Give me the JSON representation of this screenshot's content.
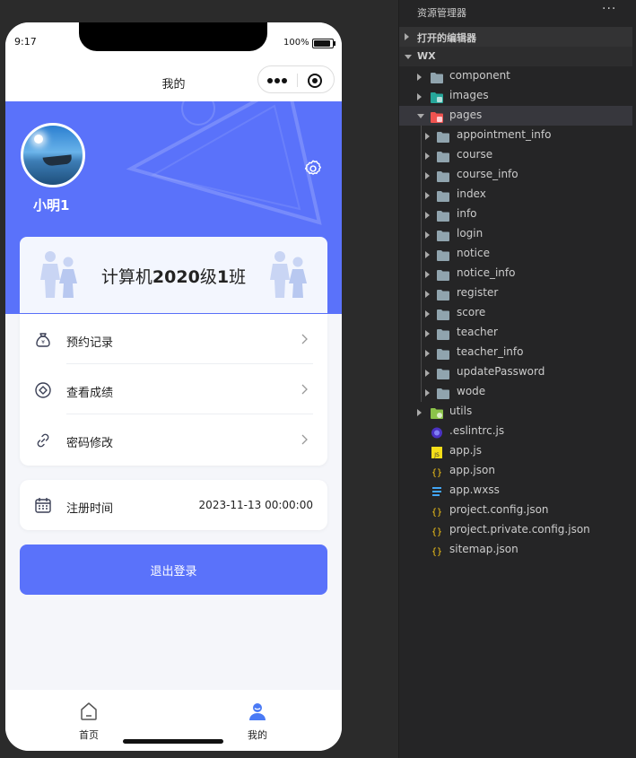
{
  "phone": {
    "status_time": "9:17",
    "battery_text": "100%",
    "nav_title": "我的",
    "username": "小明1",
    "class_prefix": "计算机",
    "class_year": "2020",
    "class_mid": "级",
    "class_num": "1",
    "class_suffix": "班",
    "menu": [
      {
        "label": "预约记录",
        "icon": "money-bag-icon"
      },
      {
        "label": "查看成绩",
        "icon": "diamond-circle-icon"
      },
      {
        "label": "密码修改",
        "icon": "link-icon"
      }
    ],
    "register": {
      "label": "注册时间",
      "value": "2023-11-13 00:00:00"
    },
    "logout_label": "退出登录",
    "tabs": [
      {
        "label": "首页",
        "icon": "home-icon"
      },
      {
        "label": "我的",
        "icon": "user-icon"
      }
    ],
    "colors": {
      "accent": "#5a72fa",
      "background": "#f5f6fa"
    }
  },
  "explorer": {
    "title": "资源管理器",
    "more": "···",
    "open_editors": "打开的编辑器",
    "project": "WX",
    "tree": [
      {
        "label": "component",
        "type": "folder"
      },
      {
        "label": "images",
        "type": "folder-images"
      },
      {
        "label": "pages",
        "type": "folder-pages",
        "expanded": true
      },
      {
        "label": "appointment_info",
        "type": "folder"
      },
      {
        "label": "course",
        "type": "folder"
      },
      {
        "label": "course_info",
        "type": "folder"
      },
      {
        "label": "index",
        "type": "folder"
      },
      {
        "label": "info",
        "type": "folder"
      },
      {
        "label": "login",
        "type": "folder"
      },
      {
        "label": "notice",
        "type": "folder"
      },
      {
        "label": "notice_info",
        "type": "folder"
      },
      {
        "label": "register",
        "type": "folder"
      },
      {
        "label": "score",
        "type": "folder"
      },
      {
        "label": "teacher",
        "type": "folder"
      },
      {
        "label": "teacher_info",
        "type": "folder"
      },
      {
        "label": "updatePassword",
        "type": "folder"
      },
      {
        "label": "wode",
        "type": "folder"
      },
      {
        "label": "utils",
        "type": "folder-utils"
      },
      {
        "label": ".eslintrc.js",
        "type": "eslint"
      },
      {
        "label": "app.js",
        "type": "js"
      },
      {
        "label": "app.json",
        "type": "json"
      },
      {
        "label": "app.wxss",
        "type": "css"
      },
      {
        "label": "project.config.json",
        "type": "json"
      },
      {
        "label": "project.private.config.json",
        "type": "json"
      },
      {
        "label": "sitemap.json",
        "type": "json"
      }
    ]
  }
}
